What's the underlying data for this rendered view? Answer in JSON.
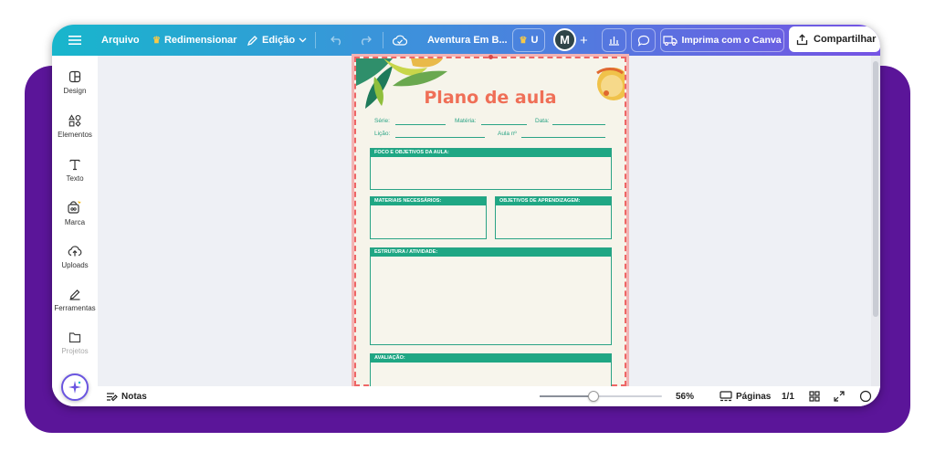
{
  "topbar": {
    "file_label": "Arquivo",
    "resize_label": "Redimensionar",
    "edit_label": "Edição",
    "doc_title": "Aventura Em B...",
    "upgrade_label": "U",
    "avatar_initial": "M",
    "print_label": "Imprima com o Canva",
    "share_label": "Compartilhar"
  },
  "sidebar": {
    "items": [
      {
        "label": "Design",
        "icon": "layout-icon"
      },
      {
        "label": "Elementos",
        "icon": "shapes-icon"
      },
      {
        "label": "Texto",
        "icon": "text-icon"
      },
      {
        "label": "Marca",
        "icon": "brand-icon"
      },
      {
        "label": "Uploads",
        "icon": "cloud-upload-icon"
      },
      {
        "label": "Ferramentas",
        "icon": "pen-tool-icon"
      },
      {
        "label": "Projetos",
        "icon": "folder-icon"
      }
    ]
  },
  "page": {
    "title": "Plano de aula",
    "fields": {
      "serie": "Série:",
      "materia": "Matéria:",
      "data": "Data:",
      "licao": "Lição:",
      "aula": "Aula nº"
    },
    "sections": {
      "foco": "FOCO E OBJETIVOS DA AULA:",
      "materiais": "MATERIAIS NECESSÁRIOS:",
      "objetivos": "OBJETIVOS DE APRENDIZAGEM:",
      "estrutura": "ESTRUTURA / ATIVIDADE:",
      "avaliacao": "AVALIAÇÃO:"
    }
  },
  "bottombar": {
    "notes_label": "Notas",
    "zoom_value": "56%",
    "zoom_fraction": 0.44,
    "pages_label": "Páginas",
    "page_count": "1/1"
  },
  "colors": {
    "accent_green": "#1fa784",
    "title_coral": "#ef6f57",
    "purple_bg": "#5b1599"
  }
}
